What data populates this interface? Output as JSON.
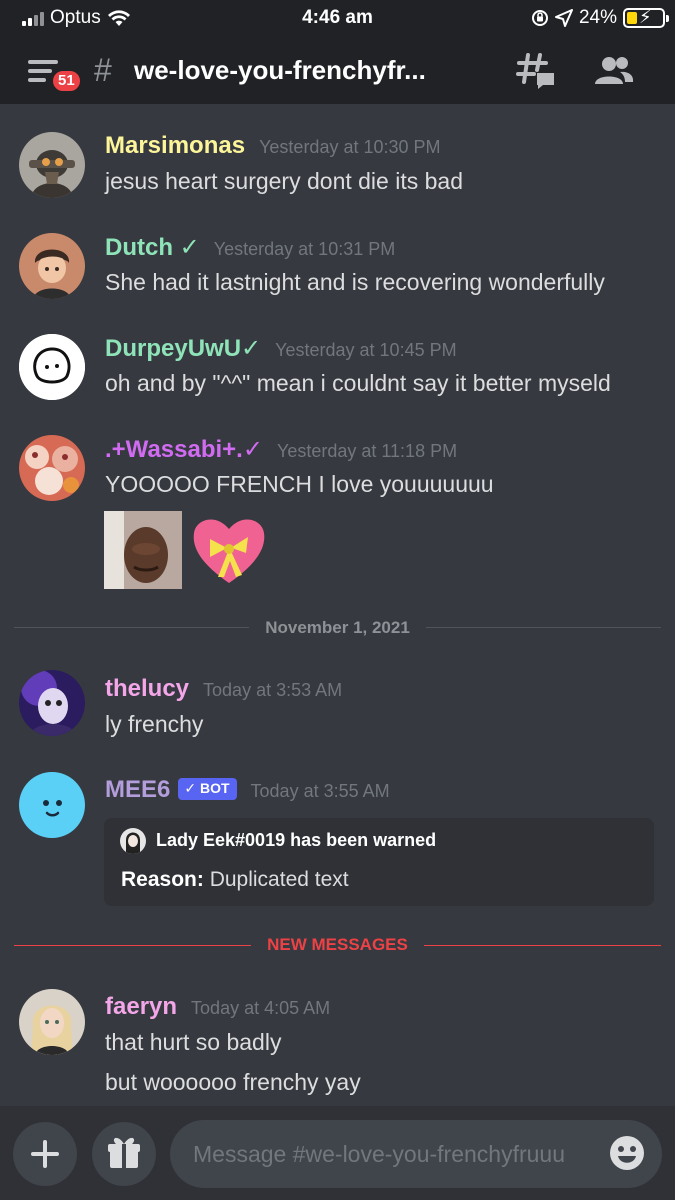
{
  "status_bar": {
    "carrier": "Optus",
    "time": "4:46 am",
    "battery_percent": "24%"
  },
  "header": {
    "badge_count": "51",
    "hash_symbol": "#",
    "channel_name": "we-love-you-frenchyfr..."
  },
  "messages": [
    {
      "username": "Marsimonas",
      "username_color": "#fdf59a",
      "timestamp": "Yesterday at 10:30 PM",
      "lines": [
        "jesus heart surgery dont die its bad"
      ]
    },
    {
      "username": "Dutch ✓",
      "username_color": "#8fe3b8",
      "timestamp": "Yesterday at 10:31 PM",
      "lines": [
        "She had it lastnight and is recovering wonderfully"
      ]
    },
    {
      "username": "DurpeyUwU✓",
      "username_color": "#8fe3b8",
      "timestamp": "Yesterday at 10:45 PM",
      "lines": [
        "oh and by \"^^\"  mean i couldnt say it better myseld"
      ]
    },
    {
      "username": ".+Wassabi+.✓",
      "username_color": "#d16cf2",
      "timestamp": "Yesterday at 11:18 PM",
      "lines": [
        "YOOOOO FRENCH I love youuuuuuu"
      ]
    },
    {
      "username": "thelucy",
      "username_color": "#f3a6e8",
      "timestamp": "Today at 3:53 AM",
      "lines": [
        "ly frenchy"
      ]
    },
    {
      "username": "MEE6",
      "username_color": "#b39ddb",
      "bot_tag": "✓ BOT",
      "timestamp": "Today at 3:55 AM",
      "embed": {
        "author": "Lady Eek#0019 has been warned",
        "field_name": "Reason:",
        "field_value": "Duplicated text"
      }
    },
    {
      "username": "faeryn",
      "username_color": "#f3a6e8",
      "timestamp": "Today at 4:05 AM",
      "lines": [
        "that hurt so badly",
        "but woooooo frenchy yay"
      ]
    }
  ],
  "dividers": {
    "date": "November 1, 2021",
    "new_messages": "NEW MESSAGES",
    "new_messages_color": "#ed4245",
    "date_color": "#8e9297"
  },
  "input": {
    "placeholder": "Message #we-love-you-frenchyfruuu"
  },
  "icons": {
    "menu": "hamburger-menu-icon",
    "threads": "threads-icon",
    "members": "members-icon",
    "add": "plus-icon",
    "gift": "gift-icon",
    "emoji": "emoji-icon"
  },
  "colors": {
    "background": "#36393f",
    "header": "#202225",
    "embed": "#2f3136",
    "accent": "#5865f2"
  }
}
